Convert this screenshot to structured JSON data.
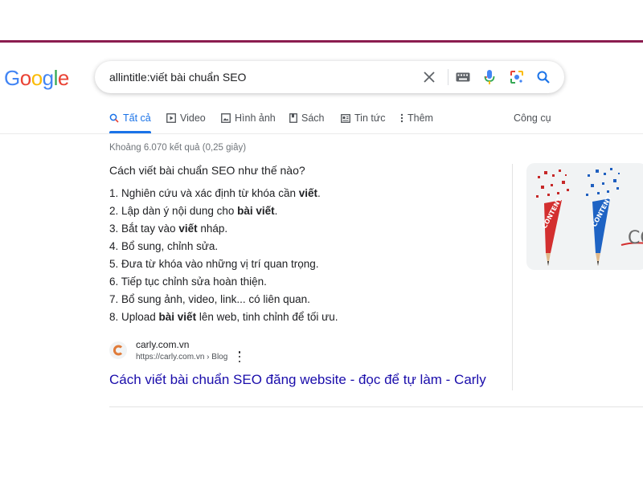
{
  "logo": {
    "letters": [
      "G",
      "o",
      "o",
      "g",
      "l",
      "e"
    ]
  },
  "search": {
    "query": "allintitle:viết bài chuẩn SEO"
  },
  "icons": {
    "clear": "close-icon",
    "keyboard": "keyboard-icon",
    "voice": "microphone-icon",
    "lens": "lens-icon",
    "search": "search-icon"
  },
  "tabs": [
    {
      "label": "Tất cả",
      "icon": "search-icon",
      "active": true
    },
    {
      "label": "Video",
      "icon": "video-icon"
    },
    {
      "label": "Hình ảnh",
      "icon": "image-icon"
    },
    {
      "label": "Sách",
      "icon": "book-icon"
    },
    {
      "label": "Tin tức",
      "icon": "news-icon"
    },
    {
      "label": "Thêm",
      "icon": "more-vert-icon"
    }
  ],
  "tools_label": "Công cụ",
  "stats": "Khoảng 6.070 kết quả (0,25 giây)",
  "snippet": {
    "title": "Cách viết bài chuẩn SEO như thế nào?",
    "steps": [
      {
        "pre": "1. Nghiên cứu và xác định từ khóa cần ",
        "bold": "viết",
        "post": "."
      },
      {
        "pre": "2. Lập dàn ý nội dung cho ",
        "bold": "bài viết",
        "post": "."
      },
      {
        "pre": "3. Bắt tay vào ",
        "bold": "viết",
        "post": " nháp."
      },
      {
        "pre": "4. Bổ sung, chỉnh sửa.",
        "bold": "",
        "post": ""
      },
      {
        "pre": "5. Đưa từ khóa vào những vị trí quan trọng.",
        "bold": "",
        "post": ""
      },
      {
        "pre": "6. Tiếp tục chỉnh sửa hoàn thiện.",
        "bold": "",
        "post": ""
      },
      {
        "pre": "7. Bổ sung ảnh, video, link... có liên quan.",
        "bold": "",
        "post": ""
      },
      {
        "pre": "8. Upload ",
        "bold": "bài viết",
        "post": " lên web, tinh chỉnh để tối ưu."
      }
    ]
  },
  "image": {
    "word": "CONTENT",
    "partial": "CO"
  },
  "source": {
    "site": "carly.com.vn",
    "url": "https://carly.com.vn › Blog",
    "favicon_letter": "C",
    "link_title": "Cách viết bài chuẩn SEO đăng website - đọc để tự làm - Carly"
  },
  "colors": {
    "accent": "#1a73e8",
    "link": "#1a0dab",
    "top_rule": "#8b1d4f",
    "google_blue": "#4285f4",
    "google_red": "#ea4335",
    "google_yellow": "#fbbc05",
    "google_green": "#34a853"
  }
}
